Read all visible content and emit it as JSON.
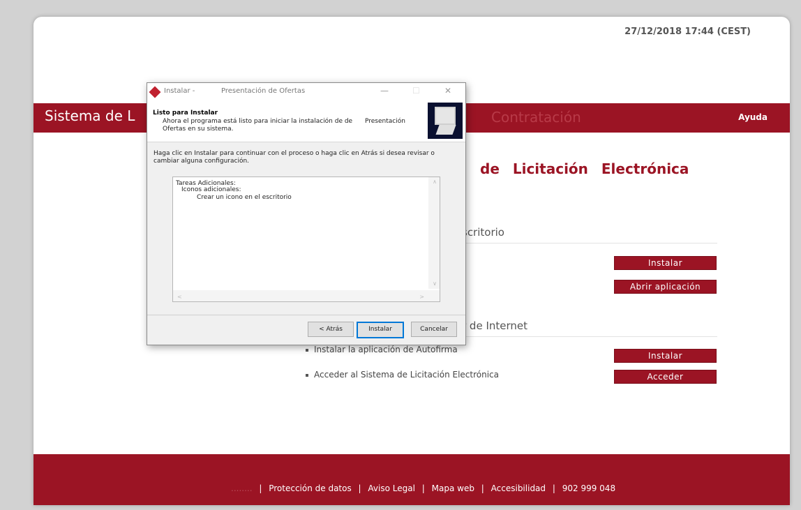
{
  "page": {
    "datetime": "27/12/2018 17:44 (CEST)",
    "site_title": "Sistema de L",
    "help_link": "Ayuda",
    "band_ghost_text": "Contratación",
    "main_title": "de Licitación Electrónica",
    "section1_heading": "scritorio",
    "section2_heading": "r de Internet",
    "section1_buttons": [
      "Instalar",
      "Abrir aplicación"
    ],
    "section2_items": [
      {
        "label": "Instalar la aplicación de Autofirma",
        "button": "Instalar"
      },
      {
        "label": "Acceder al Sistema de Licitación Electrónica",
        "button": "Acceder"
      }
    ],
    "footer": {
      "muted_prefix": "........",
      "links": [
        "Protección de datos",
        "Aviso Legal",
        "Mapa web",
        "Accesibilidad",
        "902 999 048"
      ],
      "separator": "|"
    },
    "colors": {
      "brand": "#9b1424"
    }
  },
  "dialog": {
    "title_left": "Instalar -",
    "title_right": "Presentación de Ofertas",
    "window_controls": {
      "minimize": "—",
      "maximize": "☐",
      "close": "✕"
    },
    "header_title": "Listo para Instalar",
    "header_desc": "Ahora el programa está listo para iniciar la instalación de de Ofertas en su sistema.",
    "header_extra": "Presentación",
    "body_text": "Haga clic en Instalar para continuar con el proceso o haga clic en Atrás si desea revisar o cambiar alguna configuración.",
    "list_lines": [
      "Tareas Adicionales:",
      "Iconos adicionales:",
      "Crear un icono en el escritorio"
    ],
    "buttons": {
      "back": "< Atrás",
      "install": "Instalar",
      "cancel": "Cancelar"
    },
    "scroll_arrows": {
      "up": "∧",
      "down": "∨",
      "left": "<",
      "right": ">"
    }
  }
}
